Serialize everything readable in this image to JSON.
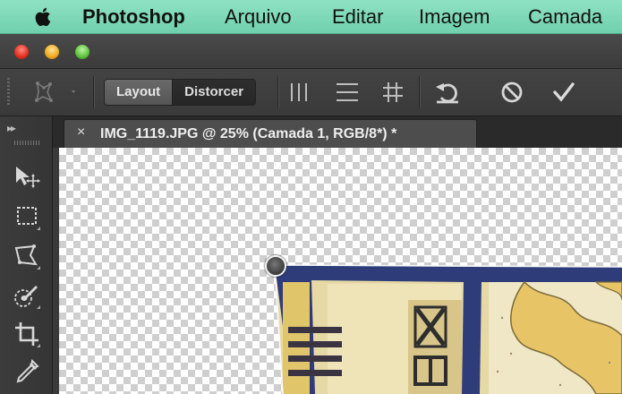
{
  "menubar": {
    "apple_icon": "apple-logo-icon",
    "app_name": "Photoshop",
    "items": [
      "Arquivo",
      "Editar",
      "Imagem",
      "Camada"
    ]
  },
  "window": {
    "controls": [
      "close",
      "minimize",
      "zoom"
    ]
  },
  "options_bar": {
    "mode_active": "Layout",
    "mode_inactive": "Distorcer",
    "icons": [
      "puppet-warp-icon",
      "vertical-lines-icon",
      "horizontal-lines-icon",
      "grid-icon",
      "undo-icon",
      "cancel-icon",
      "commit-check-icon"
    ]
  },
  "document_tab": {
    "close_symbol": "×",
    "title": "IMG_1119.JPG @ 25% (Camada 1, RGB/8*) *"
  },
  "tools_panel": {
    "collapse_symbol": "▸▸",
    "tools": [
      "move-tool-icon",
      "marquee-tool-icon",
      "lasso-tool-icon",
      "quick-selection-tool-icon",
      "crop-tool-icon",
      "eyedropper-tool-icon"
    ]
  },
  "colors": {
    "menubar": "#7fd8b8",
    "panel": "#3c3c3c",
    "active_tab": "#4d4d4d"
  }
}
